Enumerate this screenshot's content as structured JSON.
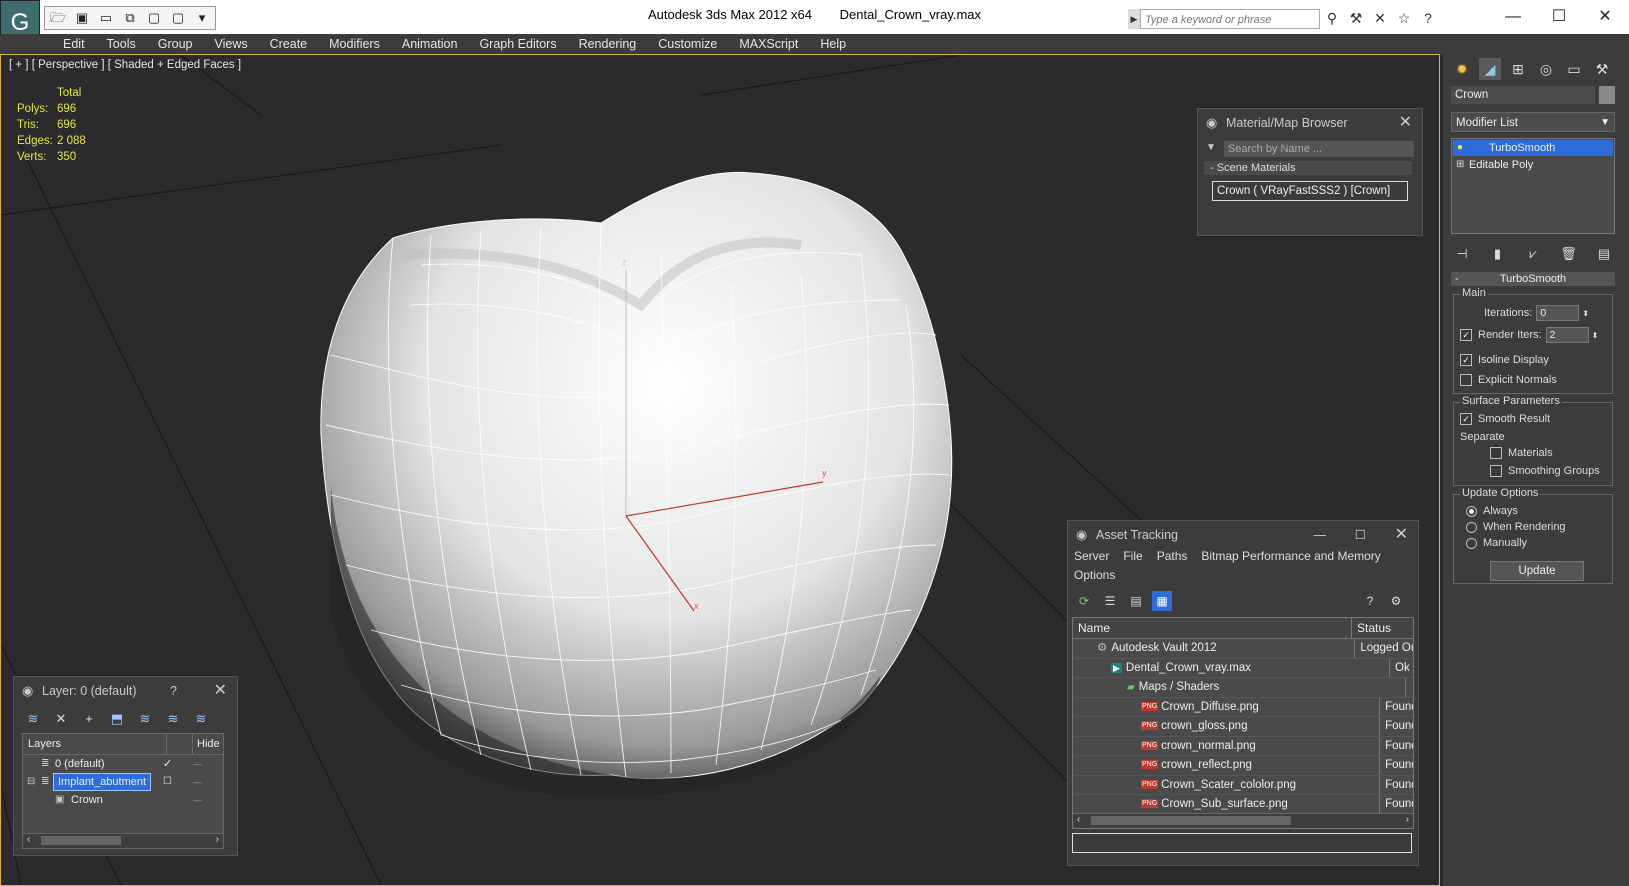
{
  "titlebar": {
    "app_name": "Autodesk 3ds Max  2012 x64",
    "file_name": "Dental_Crown_vray.max",
    "search_placeholder": "Type a keyword or phrase",
    "logo_glyph": "G"
  },
  "menubar": {
    "items": [
      "Edit",
      "Tools",
      "Group",
      "Views",
      "Create",
      "Modifiers",
      "Animation",
      "Graph Editors",
      "Rendering",
      "Customize",
      "MAXScript",
      "Help"
    ]
  },
  "viewport": {
    "label": "[ + ] [ Perspective ] [ Shaded + Edged Faces ]",
    "stats": {
      "header": "Total",
      "rows": [
        {
          "label": "Polys:",
          "value": "696"
        },
        {
          "label": "Tris:",
          "value": "696"
        },
        {
          "label": "Edges:",
          "value": "2 088"
        },
        {
          "label": "Verts:",
          "value": "350"
        }
      ]
    },
    "axis_x": "x",
    "axis_y": "y",
    "axis_z": "z"
  },
  "material_browser": {
    "title": "Material/Map Browser",
    "search_placeholder": "Search by Name ...",
    "group": "Scene Materials",
    "group_toggle": "-",
    "item": "Crown  ( VRayFastSSS2 ) [Crown]"
  },
  "command_panel": {
    "object_name": "Crown",
    "modifier_list": "Modifier List",
    "stack": [
      "TurboSmooth",
      "Editable Poly"
    ],
    "rollout_title": "TurboSmooth",
    "rollout_toggle": "-",
    "main_group": "Main",
    "iterations_label": "Iterations:",
    "iterations_value": "0",
    "render_iters_label": "Render Iters:",
    "render_iters_value": "2",
    "isoline_label": "Isoline Display",
    "explicit_normals_label": "Explicit Normals",
    "surface_group": "Surface Parameters",
    "smooth_result_label": "Smooth Result",
    "separate_label": "Separate",
    "materials_label": "Materials",
    "smoothing_groups_label": "Smoothing Groups",
    "update_group": "Update Options",
    "always_label": "Always",
    "when_rendering_label": "When Rendering",
    "manually_label": "Manually",
    "update_button": "Update",
    "checks": {
      "render_iters": true,
      "isoline": true,
      "explicit_normals": false,
      "smooth_result": true,
      "materials": false,
      "smoothing_groups": false
    },
    "update_mode": "Always"
  },
  "layer_dialog": {
    "title": "Layer: 0 (default)",
    "help": "?",
    "col_layers": "Layers",
    "col_hide": "Hide",
    "rows": [
      {
        "name": "0 (default)",
        "indent": 1
      },
      {
        "name": "Implant_abutment",
        "indent": 1
      },
      {
        "name": "Crown",
        "indent": 2
      }
    ]
  },
  "asset_tracking": {
    "title": "Asset Tracking",
    "menu": [
      "Server",
      "File",
      "Paths",
      "Bitmap Performance and Memory"
    ],
    "menu2": "Options",
    "col_name": "Name",
    "col_status": "Status",
    "rows": [
      {
        "name": "Autodesk Vault 2012",
        "status": "Logged Ou",
        "indent": 1,
        "icon": "vault-icon"
      },
      {
        "name": "Dental_Crown_vray.max",
        "status": "Ok",
        "indent": 2,
        "icon": "max-file-icon"
      },
      {
        "name": "Maps / Shaders",
        "status": "",
        "indent": 3,
        "icon": "maps-icon"
      },
      {
        "name": "Crown_Diffuse.png",
        "status": "Found",
        "indent": 4,
        "icon": "png-icon"
      },
      {
        "name": "crown_gloss.png",
        "status": "Found",
        "indent": 4,
        "icon": "png-icon"
      },
      {
        "name": "crown_normal.png",
        "status": "Found",
        "indent": 4,
        "icon": "png-icon"
      },
      {
        "name": "crown_reflect.png",
        "status": "Found",
        "indent": 4,
        "icon": "png-icon"
      },
      {
        "name": "Crown_Scater_cololor.png",
        "status": "Found",
        "indent": 4,
        "icon": "png-icon"
      },
      {
        "name": "Crown_Sub_surface.png",
        "status": "Found",
        "indent": 4,
        "icon": "png-icon"
      }
    ],
    "png_tag": "PNG"
  },
  "colors": {
    "viewport_border": "#d8b23a",
    "stats_text": "#e8e54b",
    "selection": "#2e6bdb",
    "axis_x": "#c0392b"
  }
}
